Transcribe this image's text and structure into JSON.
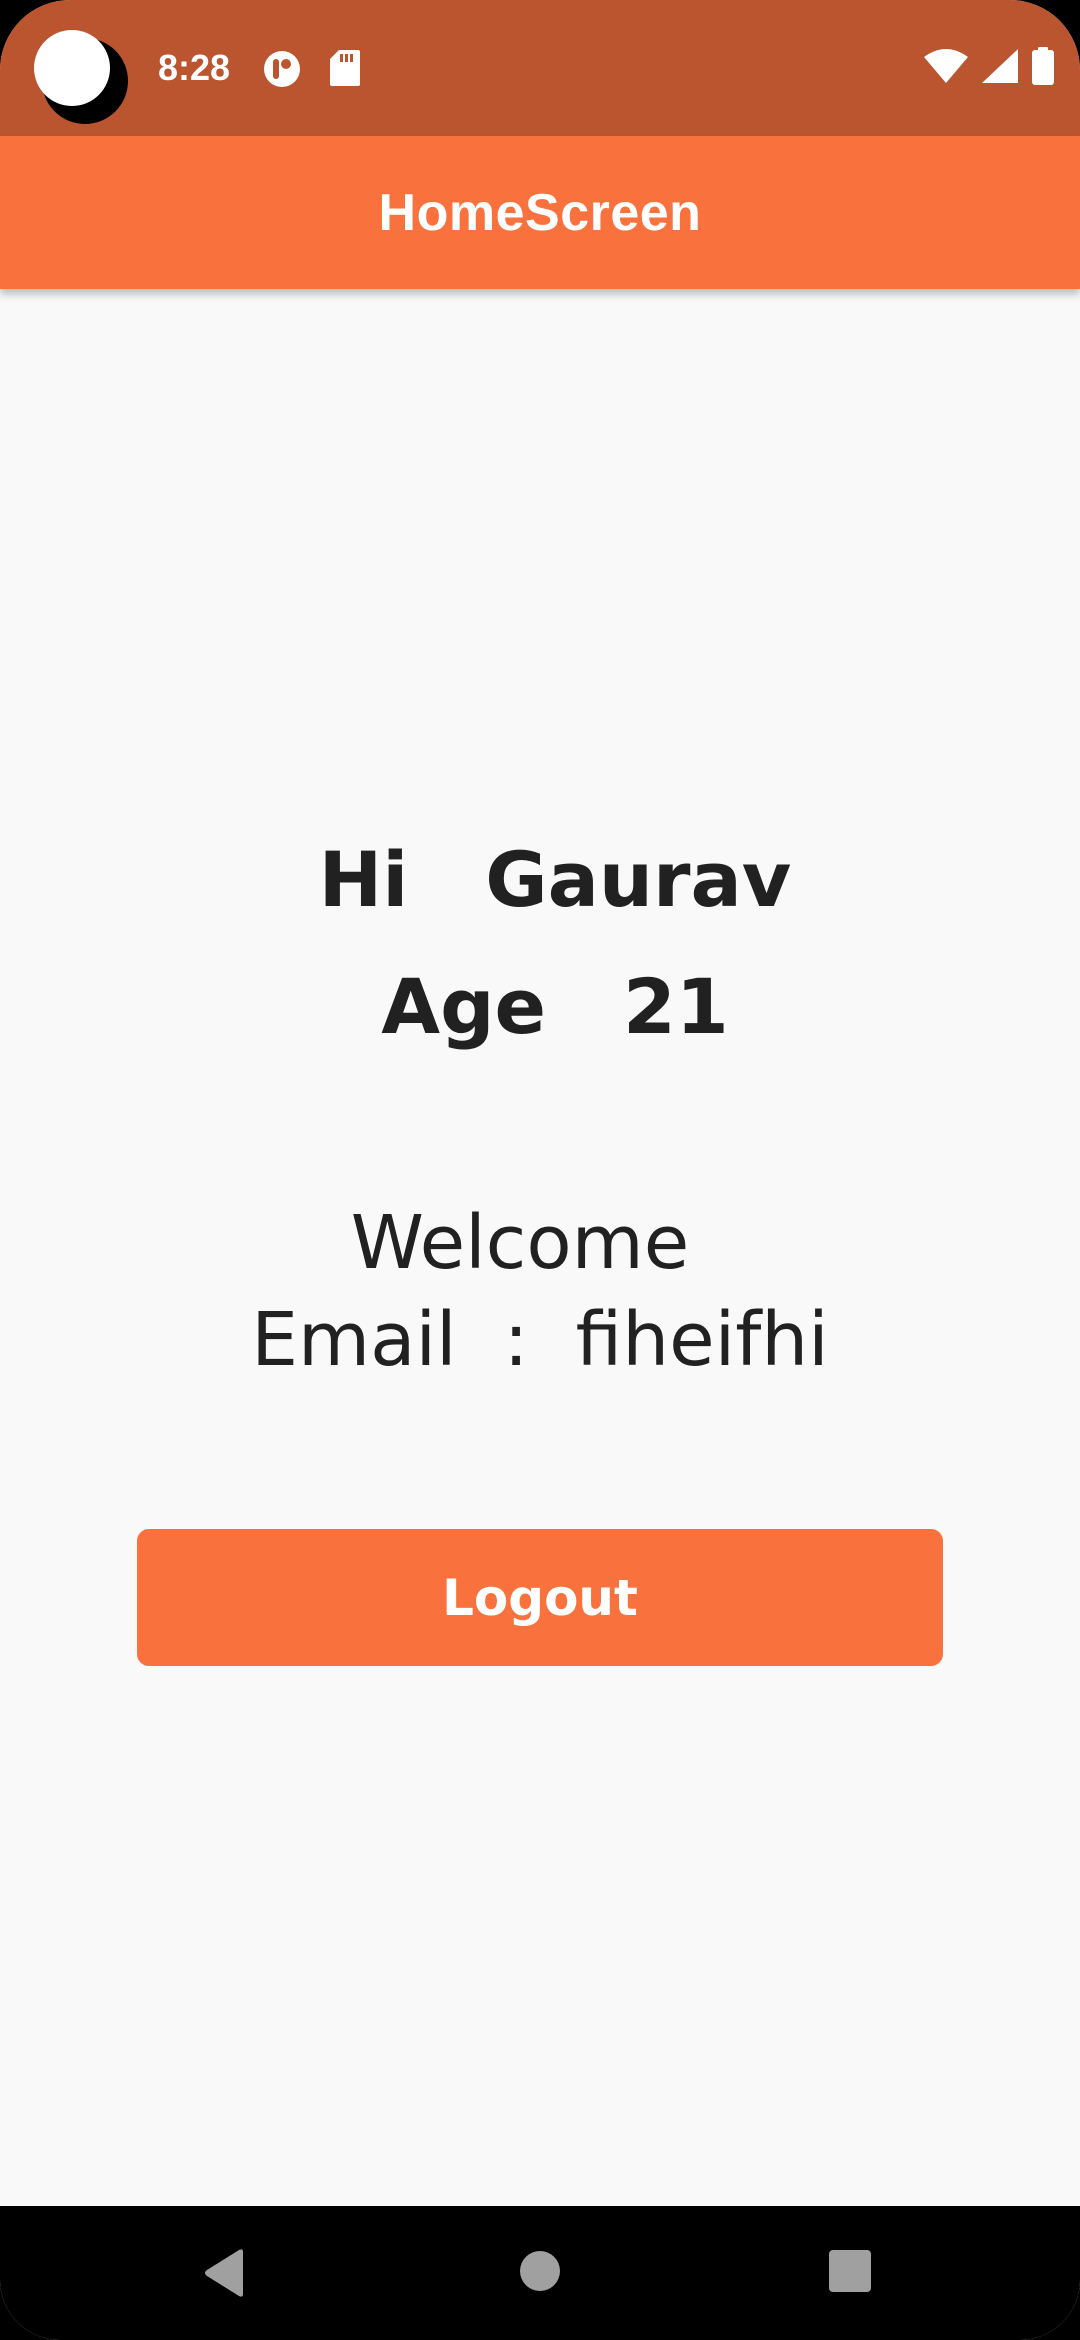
{
  "status_bar": {
    "time": "8:28",
    "icons_left": [
      "camera-cutout",
      "app-notification-icon",
      "sd-card-icon"
    ],
    "icons_right": [
      "wifi-icon",
      "cellular-signal-icon",
      "battery-icon"
    ]
  },
  "app_bar": {
    "title": "HomeScreen"
  },
  "content": {
    "greeting_name": "Hi  Gaurav",
    "greeting_age": "Age  21",
    "welcome": "Welcome",
    "email_line": "Email  :  fiheifhi"
  },
  "logout_button": {
    "label": "Logout"
  },
  "navigation": {
    "buttons": [
      "back-icon",
      "home-icon",
      "recents-icon"
    ]
  },
  "colors": {
    "status_bar": "#bb5530",
    "accent": "#f9723e",
    "background": "#f9f9f9",
    "text": "#212121"
  }
}
